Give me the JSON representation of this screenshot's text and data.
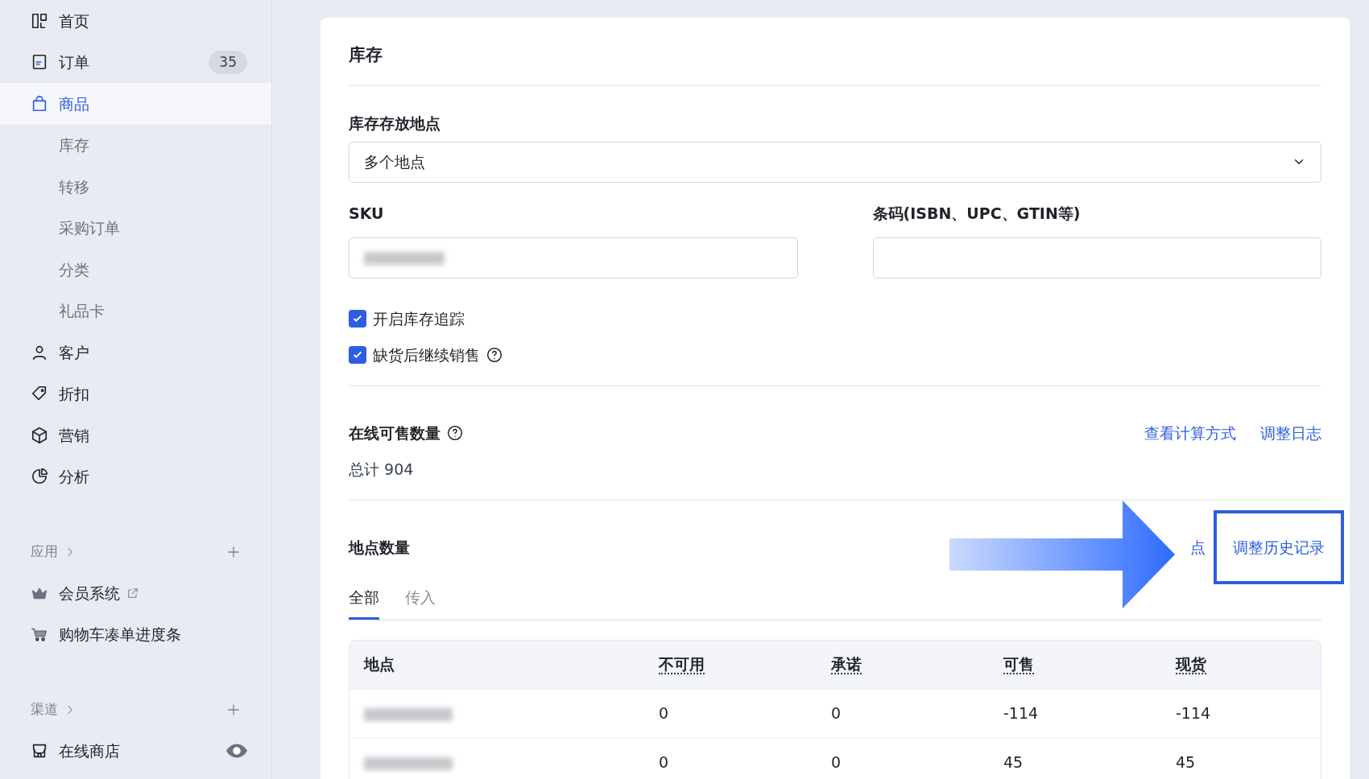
{
  "sidebar": {
    "items": [
      {
        "kind": "main",
        "label": "首页",
        "selected": false
      },
      {
        "kind": "main",
        "label": "订单",
        "badge": "35",
        "selected": false
      },
      {
        "kind": "main",
        "label": "商品",
        "selected": true
      },
      {
        "kind": "sub",
        "label": "库存",
        "selected": false
      },
      {
        "kind": "sub",
        "label": "转移",
        "selected": false
      },
      {
        "kind": "sub",
        "label": "采购订单",
        "selected": false
      },
      {
        "kind": "sub",
        "label": "分类",
        "selected": false
      },
      {
        "kind": "sub",
        "label": "礼品卡",
        "selected": false
      },
      {
        "kind": "main",
        "label": "客户",
        "selected": false
      },
      {
        "kind": "main",
        "label": "折扣",
        "selected": false
      },
      {
        "kind": "main",
        "label": "营销",
        "selected": false
      },
      {
        "kind": "main",
        "label": "分析",
        "selected": false
      }
    ],
    "sections": [
      {
        "title": "应用",
        "items": [
          {
            "label": "会员系统",
            "external": true,
            "visible": false
          },
          {
            "label": "购物车凑单进度条",
            "external": false,
            "visible": false
          }
        ]
      },
      {
        "title": "渠道",
        "items": [
          {
            "label": "在线商店",
            "external": false,
            "visible": true
          }
        ]
      }
    ]
  },
  "card": {
    "title": "库存",
    "location_field": {
      "label": "库存存放地点",
      "value": "多个地点"
    },
    "sku_field": {
      "label": "SKU"
    },
    "barcode_field": {
      "label": "条码(ISBN、UPC、GTIN等)"
    },
    "checkboxes": [
      {
        "label": "开启库存追踪",
        "checked": true,
        "help": false
      },
      {
        "label": "缺货后继续销售",
        "checked": true,
        "help": true
      }
    ],
    "online": {
      "title": "在线可售数量",
      "total": "总计 904",
      "links": [
        "查看计算方式",
        "调整日志"
      ]
    },
    "locations": {
      "title": "地点数量",
      "links": [
        {
          "label": "点",
          "highlighted": false
        },
        {
          "label": "调整历史记录",
          "highlighted": true
        }
      ],
      "tabs": [
        {
          "label": "全部",
          "selected": true
        },
        {
          "label": "传入",
          "selected": false
        }
      ],
      "table": {
        "columns": [
          {
            "label": "地点",
            "dotted": false
          },
          {
            "label": "不可用",
            "dotted": true
          },
          {
            "label": "承诺",
            "dotted": true
          },
          {
            "label": "可售",
            "dotted": true
          },
          {
            "label": "现货",
            "dotted": true
          }
        ],
        "rows": [
          {
            "cells": [
              "",
              "0",
              "0",
              "-114",
              "-114"
            ]
          },
          {
            "cells": [
              "",
              "0",
              "0",
              "45",
              "45"
            ]
          }
        ]
      }
    }
  }
}
